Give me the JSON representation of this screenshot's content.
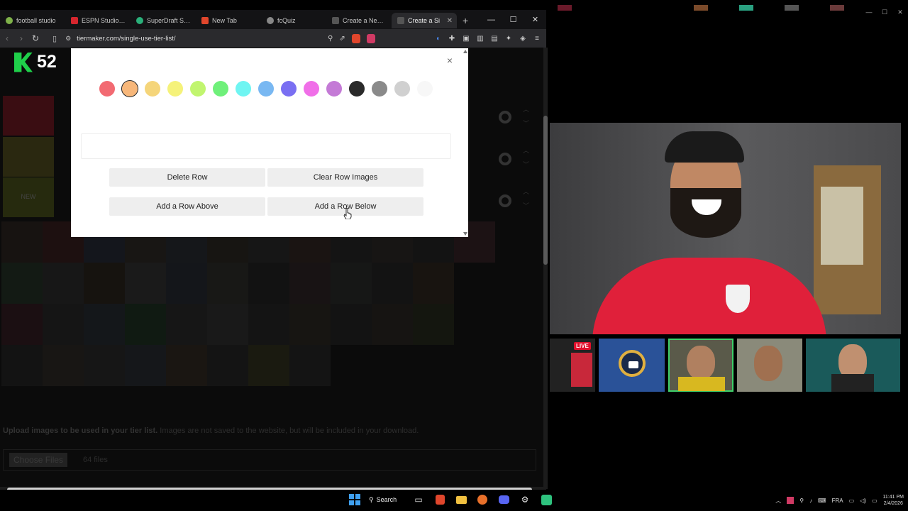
{
  "browser": {
    "tabs": [
      {
        "label": "football studio",
        "color": "#7fb24a"
      },
      {
        "label": "ESPN Studio Y B",
        "color": "#d6262e"
      },
      {
        "label": "SuperDraft Socc",
        "color": "#2ab07a"
      },
      {
        "label": "New Tab",
        "color": "#e0462c"
      },
      {
        "label": "fcQuiz",
        "color": "#888888"
      },
      {
        "label": "Create a New Ti",
        "color": "#555555"
      },
      {
        "label": "Create a Si",
        "color": "#555555",
        "active": true
      }
    ],
    "new_tab": "+",
    "window_controls": [
      "—",
      "☐",
      "✕"
    ],
    "url": "tiermaker.com/single-use-tier-list/"
  },
  "site": {
    "logo_number": "52",
    "tier_label_new": "NEW",
    "upload_bold": "Upload images to be used in your tier list.",
    "upload_rest": " Images are not saved to the website, but will be included in your download.",
    "choose_files": "Choose Files",
    "files_count": "64 files"
  },
  "modal": {
    "close": "×",
    "colors": [
      "#f26a72",
      "#f7b77a",
      "#f5d57a",
      "#f5f27a",
      "#c1f56f",
      "#6ff07a",
      "#6ff5f2",
      "#79b8f2",
      "#7a6ff2",
      "#f06fe8",
      "#c47ad6",
      "#2a2a2a",
      "#8a8a8a",
      "#d0d0d0",
      "#f7f7f7"
    ],
    "selected_color": 1,
    "delete_row": "Delete Row",
    "clear_row_images": "Clear Row Images",
    "add_row_above": "Add a Row Above",
    "add_row_below": "Add a Row Below"
  },
  "call": {
    "live_badge": "LIVE"
  },
  "taskbar": {
    "search": "Search",
    "lang": "FRA",
    "time": "11:41 PM",
    "date": "2/4/2026"
  }
}
